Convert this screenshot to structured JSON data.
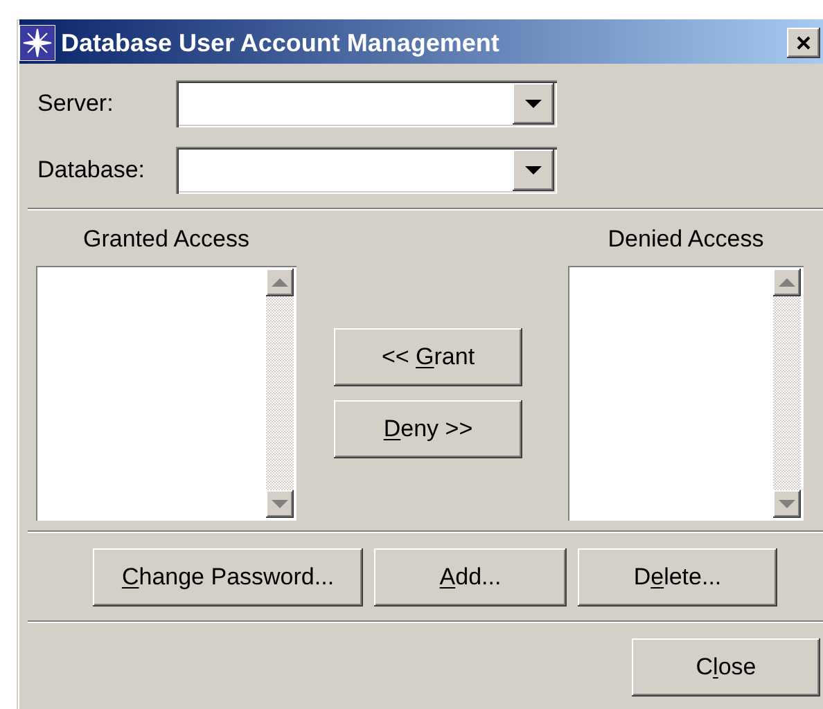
{
  "window": {
    "title": "Database User Account Management"
  },
  "fields": [
    {
      "label": "Server:"
    },
    {
      "label": "Database:"
    }
  ],
  "granted_list": {
    "title": "Granted Access"
  },
  "denied_list": {
    "title": "Denied Access"
  },
  "transfer_buttons": [
    {
      "label": {
        "before": "<< ",
        "key": "G",
        "after": "rant"
      }
    },
    {
      "label": {
        "key": "D",
        "after": "eny >>"
      }
    }
  ],
  "account_buttons": [
    {
      "label": {
        "key": "C",
        "after": "hange Password..."
      }
    },
    {
      "label": {
        "key": "A",
        "after": "dd..."
      }
    },
    {
      "label": {
        "before": "D",
        "key": "e",
        "after": "lete..."
      }
    }
  ],
  "footer_buttons": [
    {
      "label": {
        "before": "C",
        "key": "l",
        "after": "ose"
      }
    }
  ]
}
